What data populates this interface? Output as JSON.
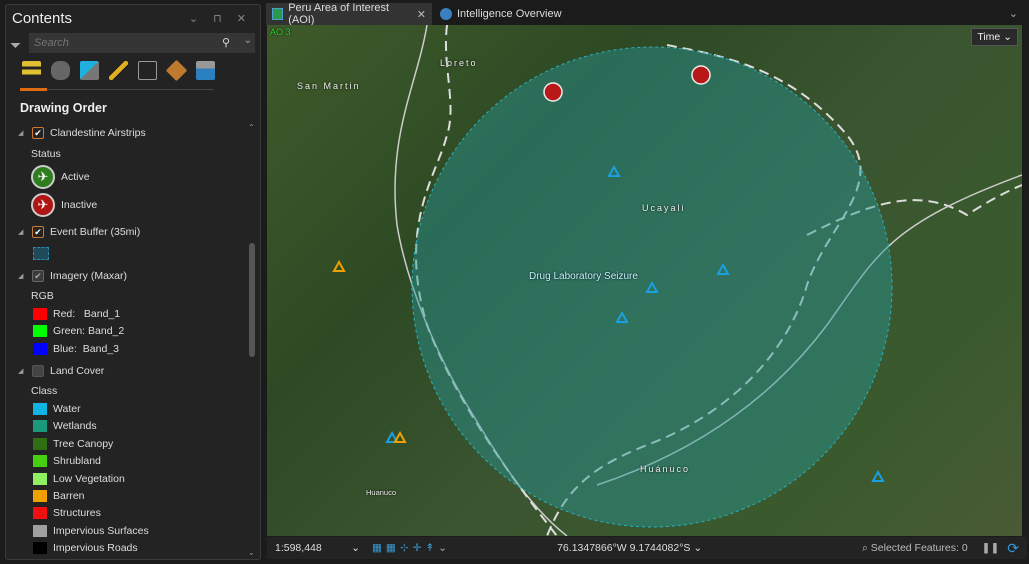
{
  "contents": {
    "title": "Contents",
    "search_placeholder": "Search",
    "section": "Drawing Order",
    "layers": [
      {
        "name": "Clandestine Airstrips",
        "checked": true,
        "group": "Status",
        "items": [
          {
            "label": "Active",
            "color": "#2e7d1e"
          },
          {
            "label": "Inactive",
            "color": "#b01515"
          }
        ]
      },
      {
        "name": "Event Buffer (35mi)",
        "checked": true
      },
      {
        "name": "Imagery (Maxar)",
        "checked": true,
        "group": "RGB",
        "items": [
          {
            "label": "Red:   Band_1",
            "color": "#ff0000"
          },
          {
            "label": "Green: Band_2",
            "color": "#00ff00"
          },
          {
            "label": "Blue:  Band_3",
            "color": "#0000ff"
          }
        ]
      },
      {
        "name": "Land Cover",
        "checked": false,
        "group": "Class",
        "items": [
          {
            "label": "Water",
            "color": "#10b4e0"
          },
          {
            "label": "Wetlands",
            "color": "#1a9a7a"
          },
          {
            "label": "Tree Canopy",
            "color": "#2f6e12"
          },
          {
            "label": "Shrubland",
            "color": "#44d010"
          },
          {
            "label": "Low Vegetation",
            "color": "#8ef060"
          },
          {
            "label": "Barren",
            "color": "#f0a000"
          },
          {
            "label": "Structures",
            "color": "#f01010"
          },
          {
            "label": "Impervious Surfaces",
            "color": "#a0a0a0"
          },
          {
            "label": "Impervious Roads",
            "color": "#000000"
          }
        ]
      }
    ]
  },
  "tabs": [
    {
      "label": "Peru Area of Interest (AOI)",
      "active": true
    },
    {
      "label": "Intelligence Overview",
      "active": false
    }
  ],
  "map": {
    "corner_label": "AO 3",
    "time_button": "Time",
    "labels": {
      "loreto": "Loreto",
      "san_martin": "San Martin",
      "ucayali": "Ucayali",
      "huanuco_region": "Huánuco",
      "huanuco_city": "Huanuco",
      "event": "Drug Laboratory Seizure"
    }
  },
  "status": {
    "scale": "1:598,448",
    "coords": "76.1347866°W 9.1744082°S",
    "selected": "Selected Features: 0"
  }
}
